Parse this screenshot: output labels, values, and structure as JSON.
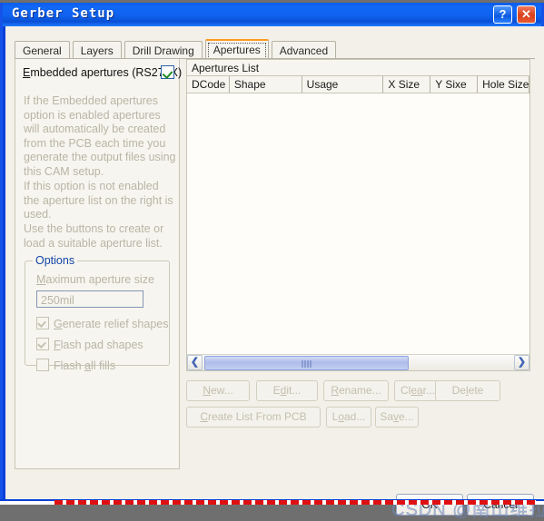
{
  "window": {
    "title": "Gerber Setup",
    "help_button": "?",
    "close_button": "✕"
  },
  "tabs": [
    {
      "label": "General",
      "active": false
    },
    {
      "label": "Layers",
      "active": false
    },
    {
      "label": "Drill Drawing",
      "active": false
    },
    {
      "label": "Apertures",
      "active": true
    },
    {
      "label": "Advanced",
      "active": false
    }
  ],
  "left_panel": {
    "embedded_checkbox_label": "Embedded apertures (RS274X)",
    "embedded_checkbox_checked": true,
    "description_1": "If the Embedded apertures option is enabled apertures will automatically be created from the PCB each time you generate the output files using this CAM setup.",
    "description_2": "If this option is not enabled the aperture list on the right is used.",
    "description_3": "Use the buttons to create or load a suitable aperture list.",
    "options": {
      "group_title": "Options",
      "max_aperture_label": "Maximum aperture size",
      "max_aperture_value": "250mil",
      "checkboxes": [
        {
          "label": "Generate relief shapes",
          "checked": true
        },
        {
          "label": "Flash pad shapes",
          "checked": true
        },
        {
          "label": "Flash all fills",
          "checked": false
        }
      ]
    }
  },
  "apertures_list": {
    "caption": "Apertures List",
    "columns": [
      "DCode",
      "Shape",
      "Usage",
      "X Size",
      "Y Sixe",
      "Hole Size"
    ],
    "rows": [],
    "scrollbar": {
      "left_arrow": "❮",
      "right_arrow": "❯"
    }
  },
  "action_buttons": {
    "row1": [
      "New...",
      "Edit...",
      "Rename...",
      "Clear...",
      "Delete"
    ],
    "row2": [
      "Create List From PCB",
      "Load...",
      "Save..."
    ]
  },
  "dialog_buttons": {
    "ok": "OK",
    "cancel": "Cancel"
  },
  "watermark": {
    "text": "CSDN @南山维拉"
  },
  "colors": {
    "titlebar_blue": "#0f62ef",
    "window_border": "#1452e8",
    "dialog_bg": "#f2f0e8",
    "list_bg": "#fffdf9",
    "active_tab_accent": "#ff9b21",
    "group_title_blue": "#1244a8",
    "disabled_text": "#b9b5a6",
    "close_red": "#d8411b"
  }
}
